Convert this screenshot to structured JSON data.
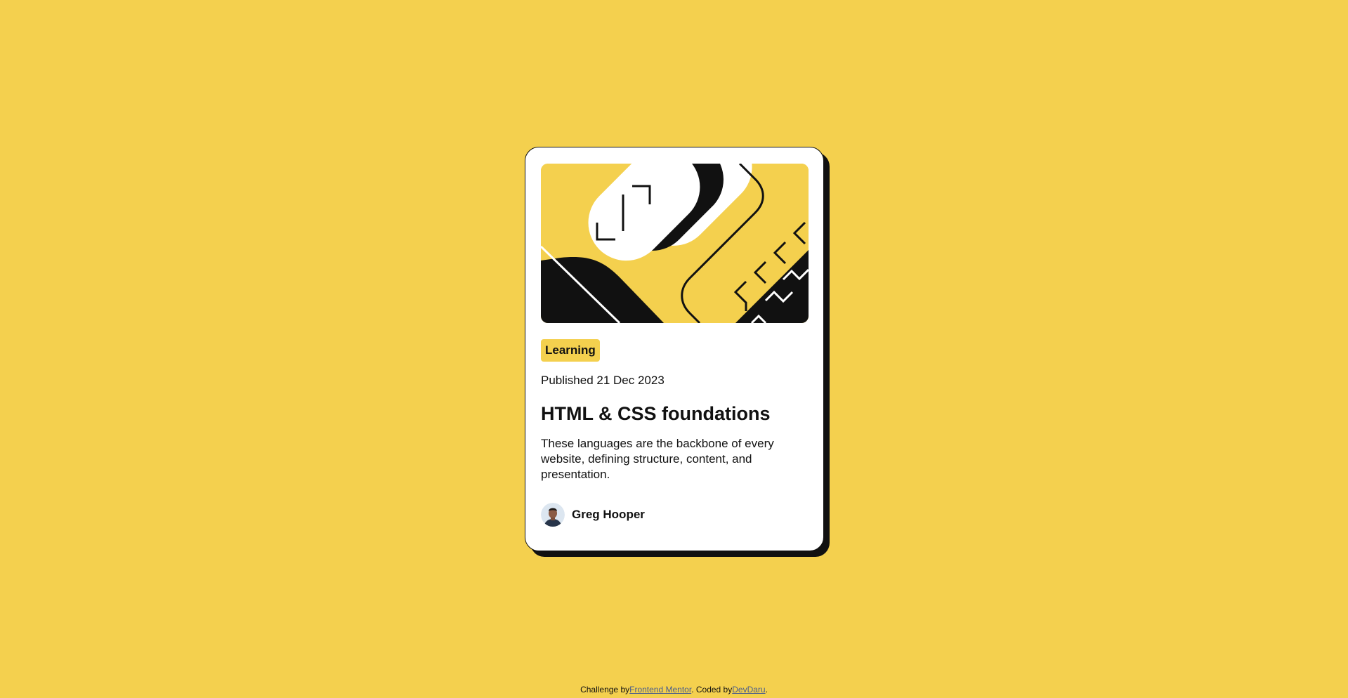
{
  "card": {
    "category": "Learning",
    "published": "Published 21 Dec 2023",
    "title": "HTML & CSS foundations",
    "description": "These languages are the backbone of every website, defining structure, content, and presentation.",
    "author": "Greg Hooper",
    "illustration_icon": "code-brackets-illustration",
    "avatar_icon": "person-avatar"
  },
  "attribution": {
    "prefix": "Challenge by",
    "link1": "Frontend Mentor",
    "middle": ". Coded by",
    "link2": "DevDaru",
    "suffix": "."
  },
  "colors": {
    "background": "#F4D04E",
    "card": "#FFFFFF",
    "ink": "#111111",
    "link": "#4B5E8C"
  }
}
